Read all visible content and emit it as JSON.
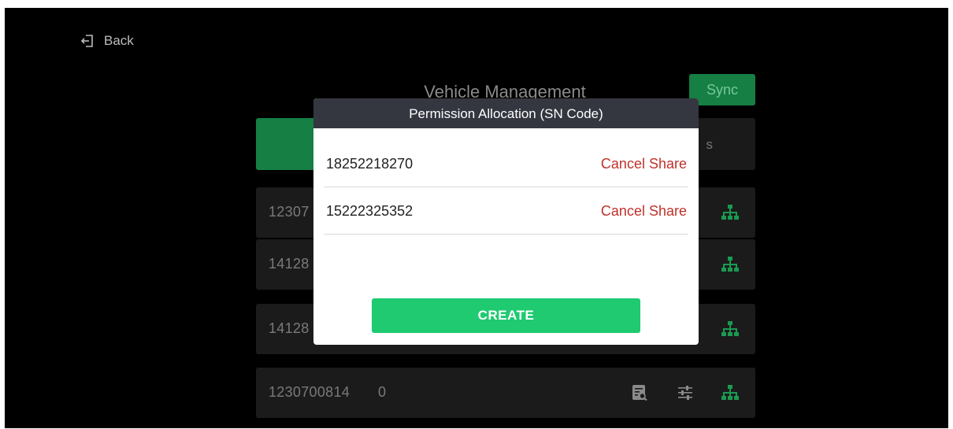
{
  "colors": {
    "accent_green": "#1fca71",
    "dark_green": "#157f44",
    "cancel_red": "#c0312b",
    "modal_header": "#343740",
    "icon_green": "#1a9a52"
  },
  "nav": {
    "back_label": "Back",
    "back_icon": "logout-arrow-icon"
  },
  "header": {
    "title": "Vehicle Management",
    "sync_label": "Sync"
  },
  "tabs": {
    "right_label": "s"
  },
  "vehicles": [
    {
      "sn": "12307",
      "count": ""
    },
    {
      "sn": "14128",
      "count": ""
    },
    {
      "sn": "14128",
      "count": ""
    },
    {
      "sn": "1230700814",
      "count": "0"
    }
  ],
  "row_icons": {
    "detail": "document-search-icon",
    "settings": "sliders-icon",
    "share": "network-tree-icon"
  },
  "modal": {
    "title": "Permission Allocation (SN Code)",
    "items": [
      {
        "sn": "18252218270",
        "action": "Cancel Share"
      },
      {
        "sn": "15222325352",
        "action": "Cancel Share"
      }
    ],
    "create_label": "CREATE"
  }
}
